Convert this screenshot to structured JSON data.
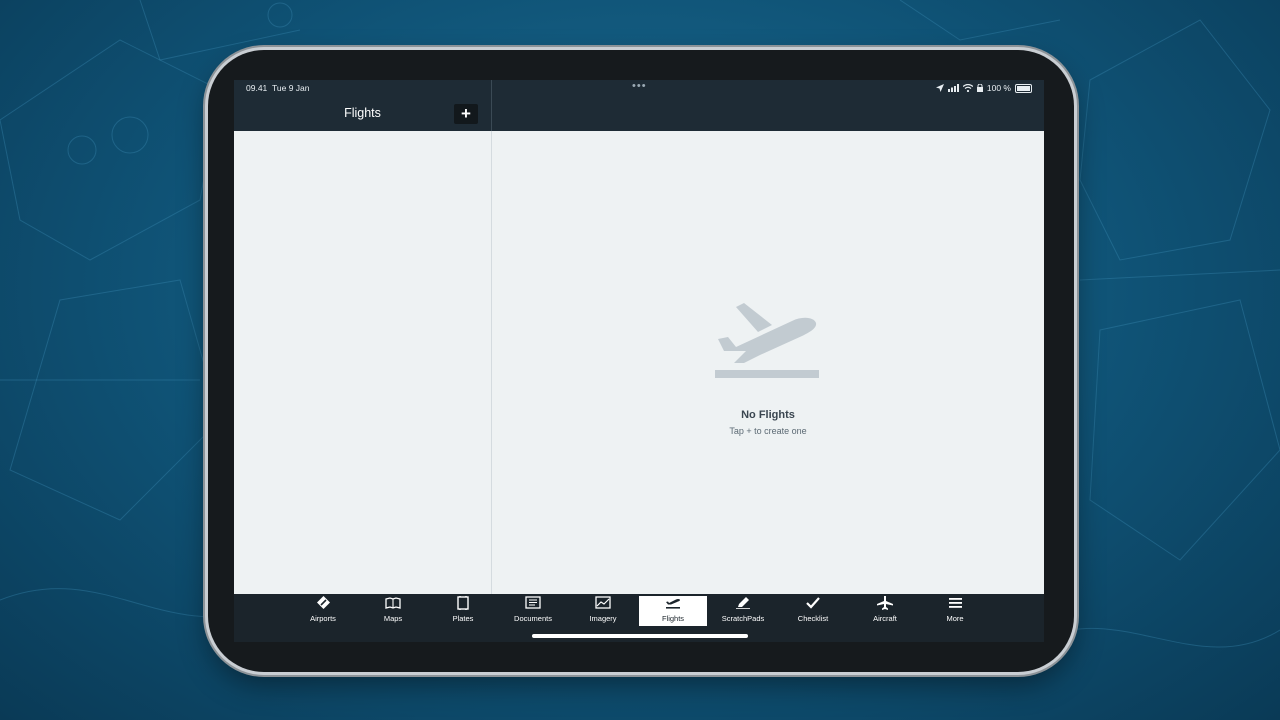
{
  "status_bar": {
    "time": "09.41",
    "date": "Tue 9 Jan",
    "multitask": "•••",
    "battery_pct": "100 %"
  },
  "header": {
    "title": "Flights",
    "add_label": "+"
  },
  "empty_state": {
    "title": "No Flights",
    "subtitle": "Tap + to create one"
  },
  "tabs": [
    {
      "label": "Airports",
      "icon": "airport-icon"
    },
    {
      "label": "Maps",
      "icon": "map-icon"
    },
    {
      "label": "Plates",
      "icon": "plates-icon"
    },
    {
      "label": "Documents",
      "icon": "documents-icon"
    },
    {
      "label": "Imagery",
      "icon": "imagery-icon"
    },
    {
      "label": "Flights",
      "icon": "flight-departure-icon",
      "active": true
    },
    {
      "label": "ScratchPads",
      "icon": "pencil-icon"
    },
    {
      "label": "Checklist",
      "icon": "checkmark-icon"
    },
    {
      "label": "Aircraft",
      "icon": "airplane-icon"
    },
    {
      "label": "More",
      "icon": "menu-icon"
    }
  ]
}
